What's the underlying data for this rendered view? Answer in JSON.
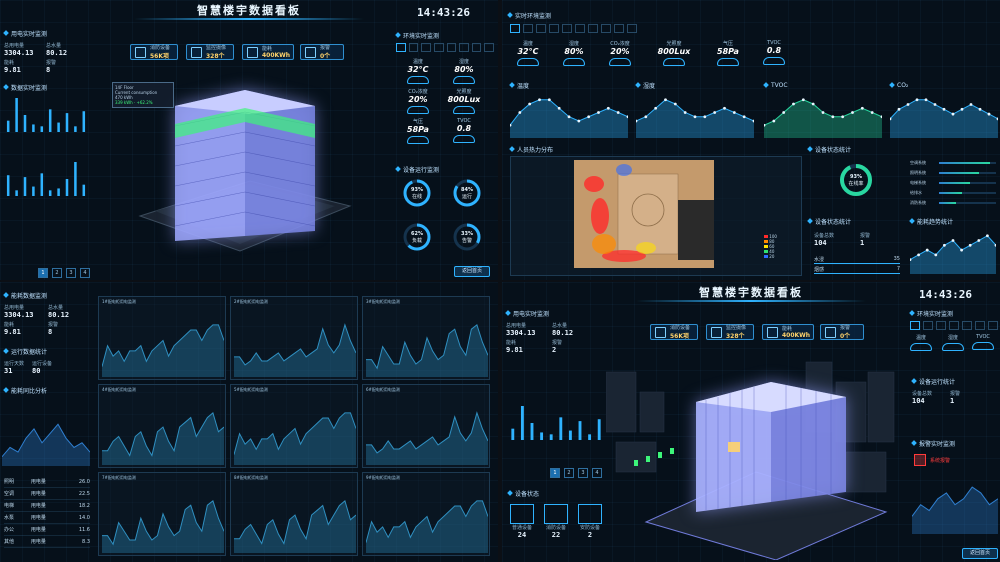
{
  "dashboard": {
    "title": "智慧楼宇数据看板",
    "clock": "14:43:26"
  },
  "metrics": [
    {
      "icon": "fire-icon",
      "label": "消防设备",
      "value": "56K项"
    },
    {
      "icon": "camera-icon",
      "label": "监控摄像",
      "value": "328个"
    },
    {
      "icon": "energy-icon",
      "label": "能耗",
      "value": "400KWh"
    },
    {
      "icon": "alarm-icon",
      "label": "报警",
      "value": "0个"
    }
  ],
  "q1": {
    "left_stats": [
      {
        "label": "总用电量",
        "value": "3304.13"
      },
      {
        "label": "总水量",
        "value": "80.12"
      },
      {
        "label": "能耗",
        "value": "9.81"
      },
      {
        "label": "报警",
        "value": "8"
      }
    ],
    "sec_energy": "用电实时监测",
    "sec_monitor": "数据实时监测",
    "sec_env": "环境实时监测",
    "sec_device": "设备运行监测",
    "floor_info": {
      "title": "14F Floor",
      "lines": [
        "Current consumption",
        "470 kWh",
        "339 kWh · +62.2%"
      ]
    },
    "env": [
      {
        "label": "温度",
        "value": "32°C"
      },
      {
        "label": "湿度",
        "value": "80%"
      },
      {
        "label": "CO₂浓度",
        "value": "20%"
      },
      {
        "label": "光照度",
        "value": "800Lux"
      },
      {
        "label": "气压",
        "value": "58Pa"
      },
      {
        "label": "TVOC",
        "value": "0.8"
      }
    ],
    "rings": [
      {
        "value": "93%",
        "label": "在线",
        "pct": 93
      },
      {
        "value": "84%",
        "label": "运行",
        "pct": 84
      },
      {
        "value": "62%",
        "label": "负载",
        "pct": 62
      },
      {
        "value": "33%",
        "label": "告警",
        "pct": 33
      }
    ],
    "button": "返回首页",
    "pager": [
      "1",
      "2",
      "3",
      "4"
    ],
    "bars": [
      6,
      18,
      9,
      4,
      3,
      12,
      5,
      10,
      3,
      11
    ]
  },
  "q2": {
    "sec_env": "实时环境监测",
    "env": [
      {
        "label": "温度",
        "value": "32°C"
      },
      {
        "label": "湿度",
        "value": "80%"
      },
      {
        "label": "CO₂浓度",
        "value": "20%"
      },
      {
        "label": "光照度",
        "value": "800Lux"
      },
      {
        "label": "气压",
        "value": "58Pa"
      },
      {
        "label": "TVOC",
        "value": "0.8"
      }
    ],
    "charts": [
      {
        "title": "温度",
        "color": "#2fb3ff",
        "values": [
          3,
          6,
          8,
          9,
          9,
          7,
          5,
          4,
          5,
          6,
          7,
          6,
          5
        ]
      },
      {
        "title": "湿度",
        "color": "#2fb3ff",
        "values": [
          4,
          5,
          7,
          9,
          8,
          6,
          5,
          5,
          6,
          7,
          6,
          5,
          4
        ]
      },
      {
        "title": "TVOC",
        "color": "#29d7a0",
        "values": [
          3,
          4,
          6,
          8,
          9,
          8,
          6,
          5,
          5,
          6,
          7,
          6,
          5
        ]
      },
      {
        "title": "CO₂",
        "color": "#2fb3ff",
        "values": [
          4,
          6,
          7,
          8,
          8,
          7,
          6,
          5,
          6,
          7,
          6,
          5,
          4
        ]
      }
    ],
    "heat_title": "人员热力分布",
    "heat_legend": [
      "100",
      "80",
      "60",
      "40",
      "20",
      "0"
    ],
    "ring": {
      "value": "93%",
      "label": "在线率"
    },
    "stats": [
      {
        "label": "设备总数",
        "value": "104"
      },
      {
        "label": "报警",
        "value": "1"
      }
    ],
    "list_rows": [
      {
        "label": "水浸",
        "value": "35"
      },
      {
        "label": "烟感",
        "value": "7"
      }
    ],
    "hbars": [
      {
        "label": "空调系统",
        "pct": 90
      },
      {
        "label": "照明系统",
        "pct": 70
      },
      {
        "label": "电梯系统",
        "pct": 55
      },
      {
        "label": "给排水",
        "pct": 40
      },
      {
        "label": "消防系统",
        "pct": 30
      }
    ],
    "sec_devices": "设备状态统计",
    "sec_trend": "能耗趋势统计",
    "trend": [
      3,
      4,
      5,
      4,
      6,
      7,
      5,
      6,
      7,
      8,
      6
    ]
  },
  "q3": {
    "left_stats": [
      {
        "label": "总用电量",
        "value": "3304.13"
      },
      {
        "label": "总水量",
        "value": "80.12"
      },
      {
        "label": "能耗",
        "value": "9.81"
      },
      {
        "label": "报警",
        "value": "8"
      }
    ],
    "sec_main": "能耗数据监测",
    "sec_ops": "运行数据统计",
    "ops": [
      {
        "label": "运行天数",
        "value": "31"
      },
      {
        "label": "运行设备",
        "value": "80"
      }
    ],
    "sec_compare": "能耗同比分析",
    "table": [
      {
        "a": "照明",
        "b": "用电量",
        "c": "26.0"
      },
      {
        "a": "空调",
        "b": "用电量",
        "c": "22.5"
      },
      {
        "a": "电梯",
        "b": "用电量",
        "c": "18.2"
      },
      {
        "a": "水泵",
        "b": "用电量",
        "c": "14.0"
      },
      {
        "a": "办公",
        "b": "用电量",
        "c": "11.6"
      },
      {
        "a": "其他",
        "b": "用电量",
        "c": "8.3"
      }
    ],
    "panels": [
      {
        "title": "1#配电柜用电监测"
      },
      {
        "title": "2#配电柜用电监测"
      },
      {
        "title": "3#配电柜用电监测"
      },
      {
        "title": "4#配电柜用电监测"
      },
      {
        "title": "5#配电柜用电监测"
      },
      {
        "title": "6#配电柜用电监测"
      },
      {
        "title": "7#配电柜用电监测"
      },
      {
        "title": "8#配电柜用电监测"
      },
      {
        "title": "9#配电柜用电监测"
      }
    ]
  },
  "q4": {
    "left_stats": [
      {
        "label": "总用电量",
        "value": "3304.13"
      },
      {
        "label": "总水量",
        "value": "80.12"
      },
      {
        "label": "能耗",
        "value": "9.81"
      },
      {
        "label": "报警",
        "value": "2"
      }
    ],
    "sec_energy": "用电实时监测",
    "sec_devices": "设备状态",
    "devices": [
      {
        "label": "普通设备",
        "value": "24"
      },
      {
        "label": "消防设备",
        "value": "22"
      },
      {
        "label": "安防设备",
        "value": "2"
      }
    ],
    "sec_env": "环境实时监测",
    "env": [
      {
        "label": "温度",
        "value": "32°C"
      },
      {
        "label": "湿度",
        "value": "80%"
      },
      {
        "label": "TVOC",
        "value": "0.8"
      }
    ],
    "sec_stats": "设备运行统计",
    "stats": [
      {
        "label": "设备总数",
        "value": "104"
      },
      {
        "label": "报警",
        "value": "1"
      }
    ],
    "sec_alarm": "报警实时监测",
    "alarm": "系统报警",
    "button": "返回首页",
    "bars": [
      6,
      18,
      9,
      4,
      3,
      12,
      5,
      10,
      3,
      11
    ],
    "pager": [
      "1",
      "2",
      "3",
      "4"
    ]
  },
  "colors": {
    "accent": "#2fb3ff",
    "gold": "#ffd36b",
    "green": "#3df57a",
    "alarm": "#ff3b3b"
  }
}
